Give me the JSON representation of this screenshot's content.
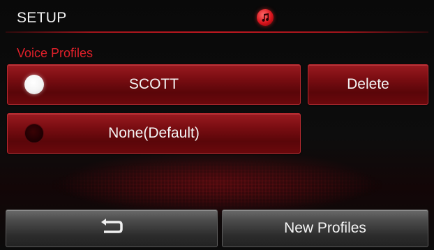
{
  "header": {
    "title": "SETUP",
    "center_icon": "music-note-icon"
  },
  "section": {
    "label": "Voice Profiles"
  },
  "profiles": [
    {
      "name": "SCOTT",
      "selected": true
    },
    {
      "name": "None(Default)",
      "selected": false
    }
  ],
  "actions": {
    "delete_label": "Delete",
    "back_icon": "back-arrow-icon",
    "new_profiles_label": "New Profiles"
  },
  "colors": {
    "accent_red": "#c01820",
    "section_label_red": "#e0202a",
    "button_gray": "#4a4a4a"
  }
}
